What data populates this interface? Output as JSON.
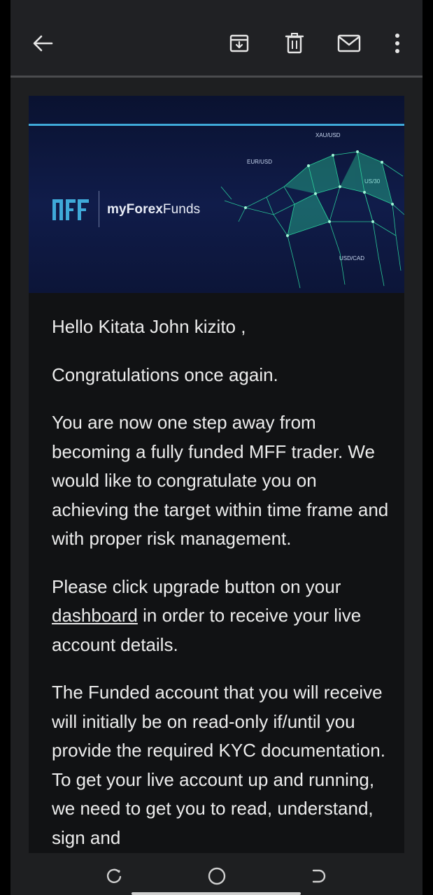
{
  "toolbar": {
    "back_icon": "arrow-left-icon",
    "archive_icon": "archive-icon",
    "delete_icon": "trash-icon",
    "mark_unread_icon": "mail-icon",
    "more_icon": "more-vert-icon"
  },
  "banner": {
    "brand_mark": "MFF",
    "brand_name_bold": "myForex",
    "brand_name_rest": "Funds",
    "tickers": [
      "XAU/USD",
      "EUR/USD",
      "US/30",
      "USD/CAD"
    ],
    "accent_color": "#3fa9d8",
    "glow_color": "#2ee6a6"
  },
  "email": {
    "greeting": "Hello Kitata John kizito ,",
    "p1": "Congratulations once again.",
    "p2": "You are now one step away from becoming a fully funded MFF trader. We would like to congratulate you on achieving the target within time frame and with proper risk management.",
    "p3_before": "Please click upgrade button on your ",
    "p3_link": "dashboard",
    "p3_after": " in order to receive your live account details.",
    "p4": "The Funded account that you will receive will initially be on read-only if/until you provide the required KYC documentation. To get your live account up and running, we need to get you to read, understand, sign and"
  },
  "nav": {
    "recents_icon": "recents-icon",
    "home_icon": "home-circle-icon",
    "back_icon": "nav-back-icon"
  }
}
